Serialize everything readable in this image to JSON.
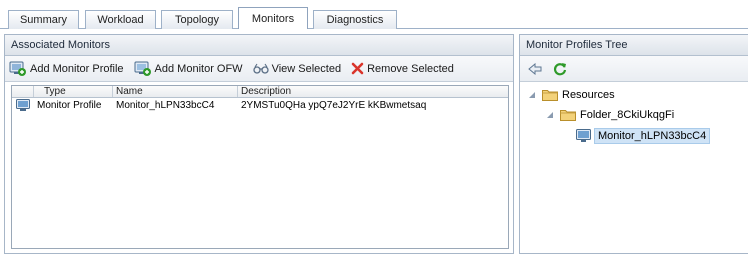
{
  "tabs": [
    "Summary",
    "Workload",
    "Topology",
    "Monitors",
    "Diagnostics"
  ],
  "left_panel": {
    "title": "Associated Monitors",
    "toolbar": {
      "add_monitor_profile": "Add Monitor Profile",
      "add_monitor_ofw": "Add Monitor OFW",
      "view_selected": "View Selected",
      "remove_selected": "Remove Selected"
    },
    "table": {
      "columns": [
        "Type",
        "Name",
        "Description"
      ],
      "rows": [
        {
          "type": "Monitor Profile",
          "name": "Monitor_hLPN33bcC4",
          "description": "2YMSTu0QHa ypQ7eJ2YrE kKBwmetsaq"
        }
      ]
    }
  },
  "right_panel": {
    "title": "Monitor Profiles Tree",
    "tree": {
      "root": "Resources",
      "folder": "Folder_8CkiUkqgFi",
      "leaf": "Monitor_hLPN33bcC4"
    }
  },
  "colors": {
    "accent_green": "#2f9a2a",
    "remove_red": "#d9342b",
    "selection": "#cfe3f6"
  }
}
